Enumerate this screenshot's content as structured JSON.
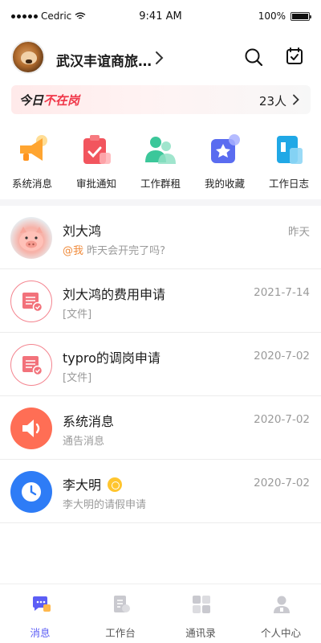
{
  "status_bar": {
    "carrier": "Cedric",
    "time": "9:41 AM",
    "battery": "100%"
  },
  "header": {
    "org_name": "武汉丰谊商旅…"
  },
  "banner": {
    "prefix": "今日",
    "highlight": "不在岗",
    "count": "23人"
  },
  "quick_actions": [
    {
      "label": "系统消息",
      "icon": "megaphone-icon",
      "color": "#ffa531"
    },
    {
      "label": "审批通知",
      "icon": "approval-clipboard-icon",
      "color": "#f2555e"
    },
    {
      "label": "工作群租",
      "icon": "group-people-icon",
      "color": "#3cc79a"
    },
    {
      "label": "我的收藏",
      "icon": "star-collection-icon",
      "color": "#5a6cf0"
    },
    {
      "label": "工作日志",
      "icon": "work-log-icon",
      "color": "#20a8e6"
    }
  ],
  "messages": [
    {
      "name": "刘大鸿",
      "mention": "@我",
      "preview": "昨天会开完了吗?",
      "date": "昨天",
      "avatar": "pig-avatar"
    },
    {
      "name": "刘大鸿的费用申请",
      "preview": "[文件]",
      "date": "2021-7-14",
      "avatar": "document-icon"
    },
    {
      "name": "typro的调岗申请",
      "preview": "[文件]",
      "date": "2020-7-02",
      "avatar": "document-icon"
    },
    {
      "name": "系统消息",
      "preview": "通告消息",
      "date": "2020-7-02",
      "avatar": "speaker-icon"
    },
    {
      "name": "李大明",
      "preview": "李大明的请假申请",
      "date": "2020-7-02",
      "avatar": "clock-icon"
    }
  ],
  "tabs": [
    {
      "label": "消息",
      "icon": "chat-bubble-icon",
      "active": true
    },
    {
      "label": "工作台",
      "icon": "workbench-icon",
      "active": false
    },
    {
      "label": "通讯录",
      "icon": "contacts-grid-icon",
      "active": false
    },
    {
      "label": "个人中心",
      "icon": "profile-icon",
      "active": false
    }
  ],
  "colors": {
    "accent": "#5c5ef5",
    "alert": "#f0384a",
    "mention": "#f08a3a"
  }
}
